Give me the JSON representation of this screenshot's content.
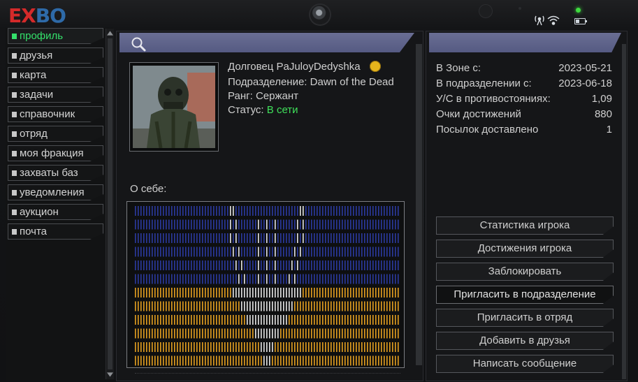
{
  "app": {
    "logo": {
      "part1": "E",
      "part2": "X",
      "part3": "BO",
      "color1": "#d42a2a",
      "color2": "#2e6aa8"
    }
  },
  "sidebar": {
    "items": [
      {
        "label": "профиль",
        "active": true
      },
      {
        "label": "друзья"
      },
      {
        "label": "карта"
      },
      {
        "label": "задачи"
      },
      {
        "label": "справочник"
      },
      {
        "label": "отряд"
      },
      {
        "label": "моя фракция"
      },
      {
        "label": "захваты баз"
      },
      {
        "label": "уведомления"
      },
      {
        "label": "аукцион"
      },
      {
        "label": "почта"
      }
    ]
  },
  "profile": {
    "name_line": "Долговец PaJuloyDedyshka",
    "division_line": "Подразделение: Dawn of the Dead",
    "rank_line": "Ранг: Сержант",
    "status_label": "Статус: ",
    "status_value": "В сети",
    "about_label": "О себе:"
  },
  "stats": {
    "rows": [
      {
        "key": "В Зоне с:",
        "value": "2023-05-21"
      },
      {
        "key": "В подразделении с:",
        "value": "2023-06-18"
      },
      {
        "key": "У/С в противостояниях:",
        "value": "1,09"
      },
      {
        "key": "Очки достижений",
        "value": "880"
      },
      {
        "key": "Посылок доставлено",
        "value": "1"
      }
    ]
  },
  "actions": [
    {
      "label": "Статистика игрока"
    },
    {
      "label": "Достижения игрока"
    },
    {
      "label": "Заблокировать"
    },
    {
      "label": "Пригласить в подразделение",
      "highlighted": true
    },
    {
      "label": "Пригласить в отряд"
    },
    {
      "label": "Добавить в друзья"
    },
    {
      "label": "Написать сообщение"
    }
  ],
  "colors": {
    "accent_green": "#34e06b",
    "online_green": "#3fe05a",
    "header_blue": "#5a5f88",
    "flag_blue": "#2b3aa0",
    "flag_yellow": "#e5a020"
  }
}
